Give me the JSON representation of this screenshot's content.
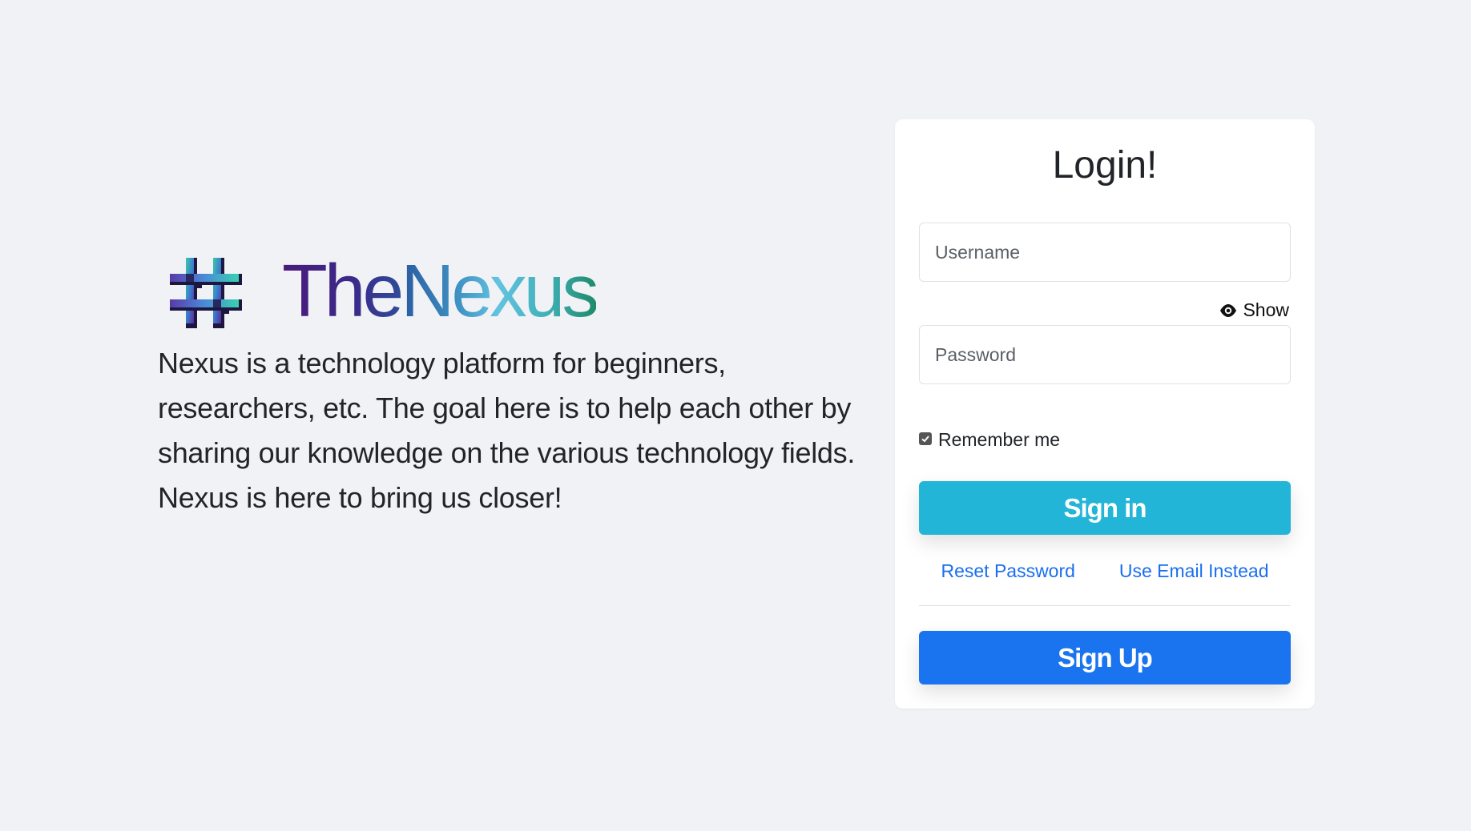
{
  "brand": {
    "name_part1": "The",
    "name_part2": "Nexus",
    "logo": "hash-logo-icon"
  },
  "hero": {
    "description": "Nexus is a technology platform for beginners, researchers, etc. The goal here is to help each other by sharing our knowledge on the various technology fields. Nexus is here to bring us closer!"
  },
  "login": {
    "title": "Login!",
    "username_placeholder": "Username",
    "password_placeholder": "Password",
    "show_label": "Show",
    "show_icon": "eye-icon",
    "remember_label": "Remember me",
    "remember_checked": true,
    "signin_label": "Sign in",
    "reset_password_label": "Reset Password",
    "use_email_label": "Use Email Instead",
    "signup_label": "Sign Up"
  },
  "colors": {
    "background": "#f0f2f5",
    "signin_button": "#23b5d8",
    "signup_button": "#1a74f0",
    "link": "#1a6ef0"
  }
}
